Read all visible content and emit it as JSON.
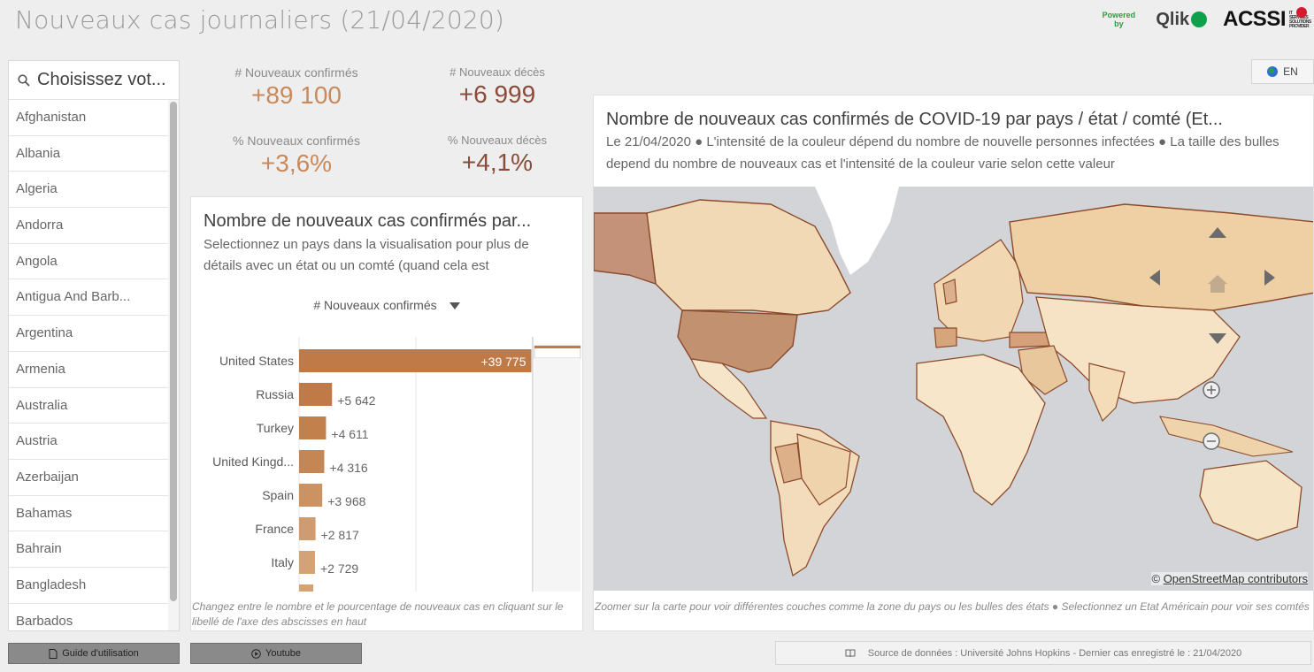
{
  "header": {
    "title": "Nouveaux cas journaliers (21/04/2020)",
    "powered_by": "Powered by",
    "qlik": "Qlik",
    "acssi": "ACSSI",
    "acssi_tag": "IT SERVICES SOLUTIONS PROVIDER"
  },
  "country_list": {
    "search_placeholder": "Choisissez vot...",
    "items": [
      "Afghanistan",
      "Albania",
      "Algeria",
      "Andorra",
      "Angola",
      "Antigua And Barb...",
      "Argentina",
      "Armenia",
      "Australia",
      "Austria",
      "Azerbaijan",
      "Bahamas",
      "Bahrain",
      "Bangladesh",
      "Barbados"
    ]
  },
  "kpis": {
    "new_confirmed_label": "# Nouveaux confirmés",
    "new_confirmed_value": "+89 100",
    "new_deaths_label": "# Nouveaux décès",
    "new_deaths_value": "+6 999",
    "pct_confirmed_label": "% Nouveaux confirmés",
    "pct_confirmed_value": "+3,6%",
    "pct_deaths_label": "% Nouveaux décès",
    "pct_deaths_value": "+4,1%",
    "confirmed_color": "#c98a5b",
    "deaths_color": "#8a4b3b"
  },
  "bar_panel": {
    "title": "Nombre de nouveaux cas confirmés par...",
    "subtitle": "Selectionnez un pays dans la visualisation pour plus de détails avec un état ou un comté (quand cela est",
    "measure": "# Nouveaux confirmés",
    "footnote": "Changez entre le nombre et le pourcentage de nouveaux cas en cliquant sur le libellé de l'axe des abscisses en haut"
  },
  "chart_data": {
    "type": "bar",
    "orientation": "horizontal",
    "categories": [
      "United States",
      "Russia",
      "Turkey",
      "United Kingd...",
      "Spain",
      "France",
      "Italy"
    ],
    "values": [
      39775,
      5642,
      4611,
      4316,
      3968,
      2817,
      2729
    ],
    "labels": [
      "+39 775",
      "+5 642",
      "+4 611",
      "+4 316",
      "+3 968",
      "+2 817",
      "+2 729"
    ],
    "colors": [
      "#bf7a47",
      "#bf7a47",
      "#c2804d",
      "#c58655",
      "#cc9262",
      "#d09c6f",
      "#d3a375"
    ],
    "xlim": [
      0,
      40000
    ]
  },
  "map_panel": {
    "lang_label": "EN",
    "title": "Nombre de nouveaux cas confirmés de COVID-19 par pays / état / comté (Et...",
    "subtitle": "Le 21/04/2020 ● L'intensité de la couleur dépend du nombre de nouvelle personnes infectées ● La taille des bulles depend du nombre de nouveaux cas et l'intensité de la couleur varie selon cette valeur",
    "attribution_prefix": "©",
    "attribution_link": "OpenStreetMap contributors",
    "footnote": "Zoomer sur la carte pour voir différentes couches comme la zone du pays ou les bulles des états ● Selectionnez un Etat Américain pour voir ses comtés"
  },
  "footer": {
    "guide_button": "Guide d'utilisation",
    "youtube_button": "Youtube",
    "source": "Source de données : Université Johns Hopkins - Dernier cas enregistré le : 21/04/2020"
  }
}
